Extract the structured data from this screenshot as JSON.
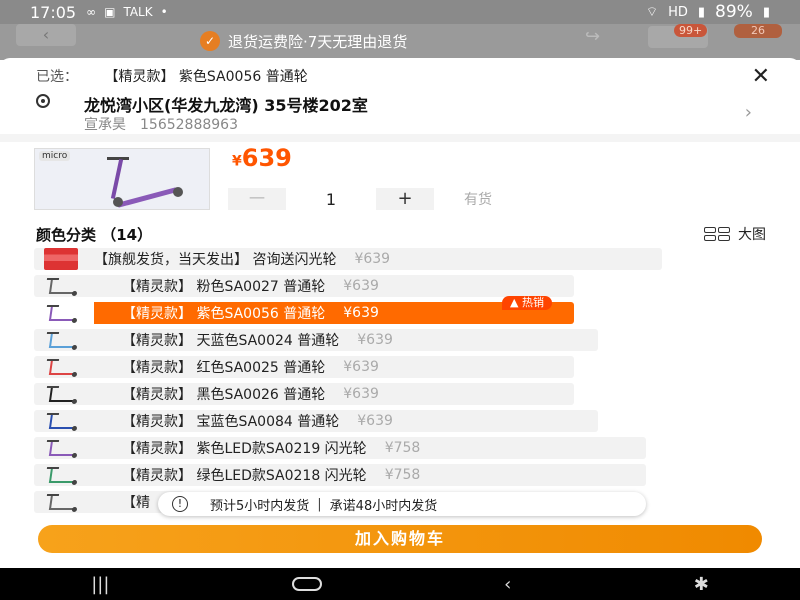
{
  "status_bar": {
    "time": "17:05",
    "icons": [
      "∞",
      "▣",
      "TALK",
      "•"
    ],
    "network": "HD",
    "battery": "89%"
  },
  "banner": {
    "text": "退货运费险·7天无理由退货"
  },
  "cart_badges": {
    "left": "99+",
    "right": "26"
  },
  "sheet": {
    "selected_label": "已选：",
    "selected_value": "【精灵款】 紫色SA0056 普通轮",
    "address": {
      "street": "龙悦湾小区(华发九龙湾) 35号楼202室",
      "name": "宣承昊",
      "phone": "15652888963"
    },
    "price": {
      "symbol": "¥",
      "amount": "639"
    },
    "quantity": {
      "minus": "一",
      "value": "1",
      "plus": "+",
      "stock": "有货"
    },
    "color_section": {
      "title": "颜色分类 （14）",
      "big_view": "大图"
    },
    "options": [
      {
        "label": "【旗舰发货，当天发出】 咨询送闪光轮",
        "price": "¥639"
      },
      {
        "label": "【精灵款】 粉色SA0027 普通轮",
        "price": "¥639"
      },
      {
        "label": "【精灵款】 紫色SA0056 普通轮",
        "price": "¥639",
        "tag": "热销"
      },
      {
        "label": "【精灵款】 天蓝色SA0024 普通轮",
        "price": "¥639"
      },
      {
        "label": "【精灵款】 红色SA0025 普通轮",
        "price": "¥639"
      },
      {
        "label": "【精灵款】 黑色SA0026 普通轮",
        "price": "¥639"
      },
      {
        "label": "【精灵款】 宝蓝色SA0084 普通轮",
        "price": "¥639"
      },
      {
        "label": "【精灵款】 紫色LED款SA0219 闪光轮",
        "price": "¥758"
      },
      {
        "label": "【精灵款】 绿色LED款SA0218 闪光轮",
        "price": "¥758"
      },
      {
        "label": "【精",
        "price": ""
      }
    ],
    "toast": {
      "part1": "预计5小时内发货",
      "separator": "|",
      "part2": "承诺48小时内发货"
    },
    "add_to_cart": "加入购物车"
  },
  "colors": {
    "accent": "#ff6a00",
    "price": "#ff5500",
    "button": "#f59a00"
  }
}
